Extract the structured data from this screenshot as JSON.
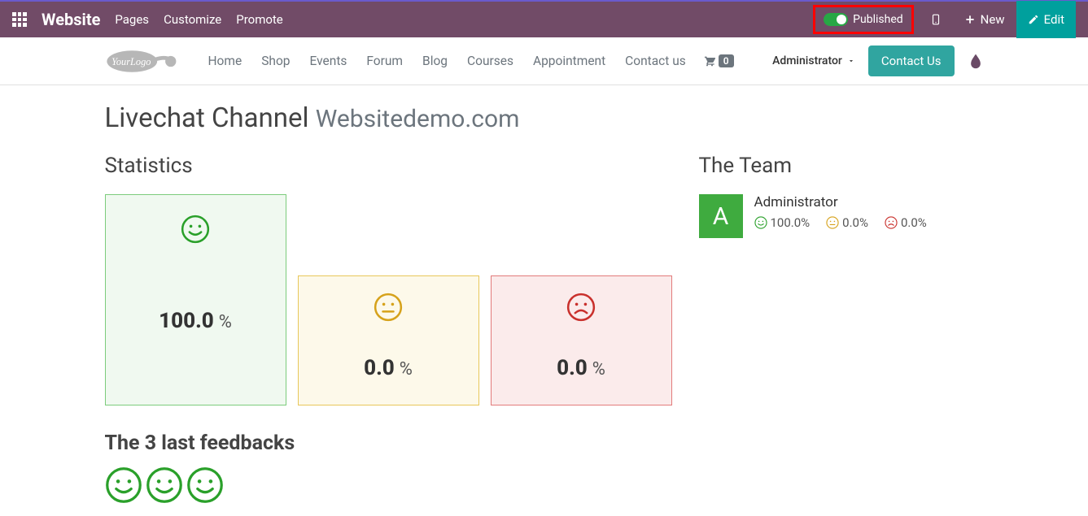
{
  "topbar": {
    "brand": "Website",
    "items": [
      "Pages",
      "Customize",
      "Promote"
    ],
    "published": "Published",
    "new": "New",
    "edit": "Edit"
  },
  "secnav": {
    "logo_text": "YourLogo",
    "items": [
      "Home",
      "Shop",
      "Events",
      "Forum",
      "Blog",
      "Courses",
      "Appointment",
      "Contact us"
    ],
    "cart_count": "0",
    "admin": "Administrator",
    "contact": "Contact Us"
  },
  "page": {
    "title_main": "Livechat Channel",
    "title_sub": "Websitedemo.com"
  },
  "statistics": {
    "heading": "Statistics",
    "green_value": "100.0",
    "green_pct": "%",
    "yellow_value": "0.0",
    "yellow_pct": "%",
    "red_value": "0.0",
    "red_pct": "%"
  },
  "feedback": {
    "heading": "The 3 last feedbacks"
  },
  "team": {
    "heading": "The Team",
    "members": [
      {
        "initial": "A",
        "name": "Administrator",
        "happy": "100.0%",
        "neutral": "0.0%",
        "sad": "0.0%"
      }
    ]
  }
}
